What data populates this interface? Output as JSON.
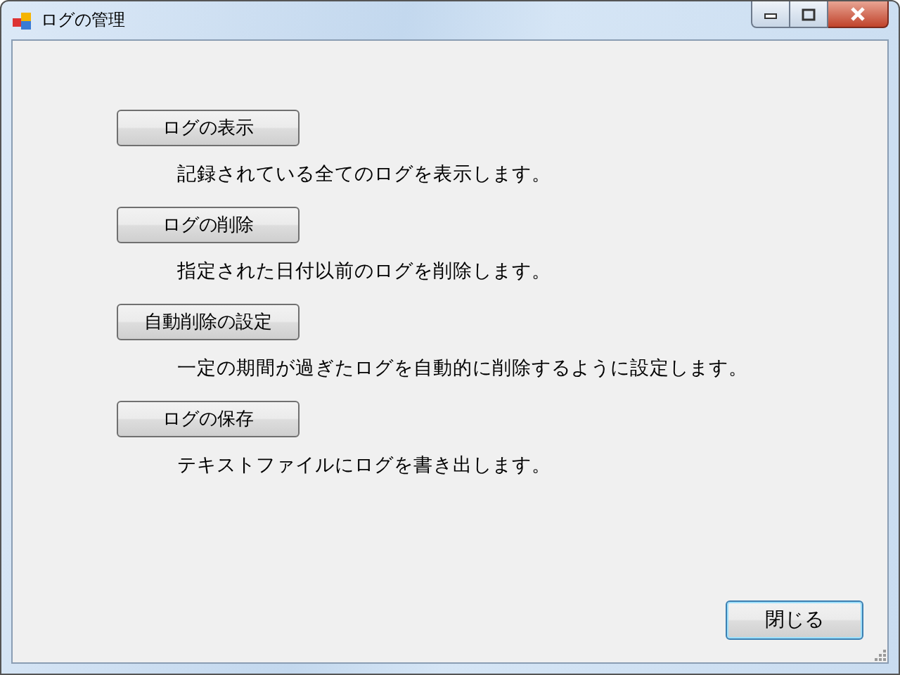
{
  "window": {
    "title": "ログの管理"
  },
  "actions": [
    {
      "label": "ログの表示",
      "description": "記録されている全てのログを表示します。"
    },
    {
      "label": "ログの削除",
      "description": "指定された日付以前のログを削除します。"
    },
    {
      "label": "自動削除の設定",
      "description": "一定の期間が過ぎたログを自動的に削除するように設定します。"
    },
    {
      "label": "ログの保存",
      "description": "テキストファイルにログを書き出します。"
    }
  ],
  "close_button": {
    "label": "閉じる",
    "focused": true
  }
}
